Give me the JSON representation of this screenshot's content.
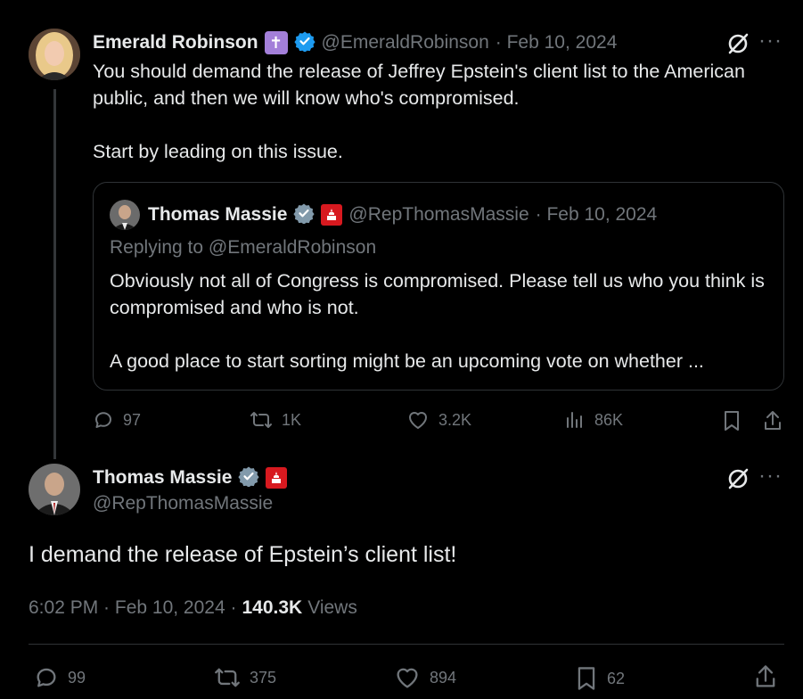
{
  "tweet1": {
    "name": "Emerald Robinson",
    "handle": "@EmeraldRobinson",
    "date": "· Feb 10, 2024",
    "text": "You should demand the release of Jeffrey Epstein's client list to the American public, and then we will know who's compromised.\n\nStart by leading on this issue.",
    "badges": [
      "cross-badge",
      "verified-badge"
    ],
    "quote": {
      "name": "Thomas Massie",
      "handle": "@RepThomasMassie",
      "date": "· Feb 10, 2024",
      "replying_to": "Replying to @EmeraldRobinson",
      "text": "Obviously not all of Congress is compromised. Please tell us who you think is compromised and who is not.\n\nA good place to start sorting might be an upcoming vote on whether ..."
    },
    "actions": {
      "replies": "97",
      "reposts": "1K",
      "likes": "3.2K",
      "views": "86K"
    }
  },
  "tweet2": {
    "name": "Thomas Massie",
    "handle": "@RepThomasMassie",
    "text": "I demand the release of Epstein’s client list!",
    "time": "6:02 PM · Feb 10, 2024 ·",
    "views_count": "140.3K",
    "views_label": "Views",
    "actions": {
      "replies": "99",
      "reposts": "375",
      "likes": "894",
      "bookmarks": "62"
    }
  },
  "colors": {
    "background": "#000000",
    "text": "#e7e9ea",
    "muted": "#71767b",
    "verified": "#1d9bf0",
    "border": "#2f3336"
  }
}
